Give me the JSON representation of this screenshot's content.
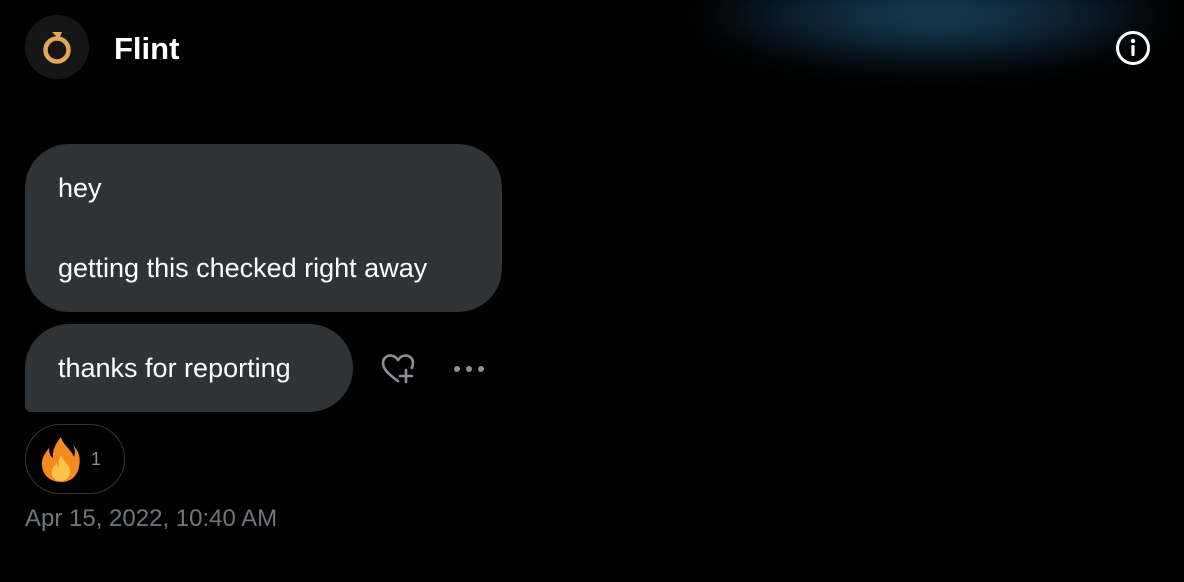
{
  "conversation": {
    "name": "Flint",
    "avatar_icon": "flint-logo-icon",
    "info_icon": "info-icon"
  },
  "messages": [
    {
      "lines": [
        "hey",
        "getting this checked right away"
      ]
    },
    {
      "lines": [
        "thanks for reporting"
      ]
    }
  ],
  "message_actions": {
    "react_icon": "heart-plus-icon",
    "more_icon": "more-horizontal-icon"
  },
  "reaction": {
    "emoji_icon": "fire-emoji-icon",
    "count": "1"
  },
  "timestamp": "Apr 15, 2022, 10:40 AM",
  "colors": {
    "background": "#000000",
    "bubble": "#2f3336",
    "text": "#ffffff",
    "muted": "#71767b",
    "avatar_accent": "#e3a857",
    "glow": "#1d4e6e"
  }
}
